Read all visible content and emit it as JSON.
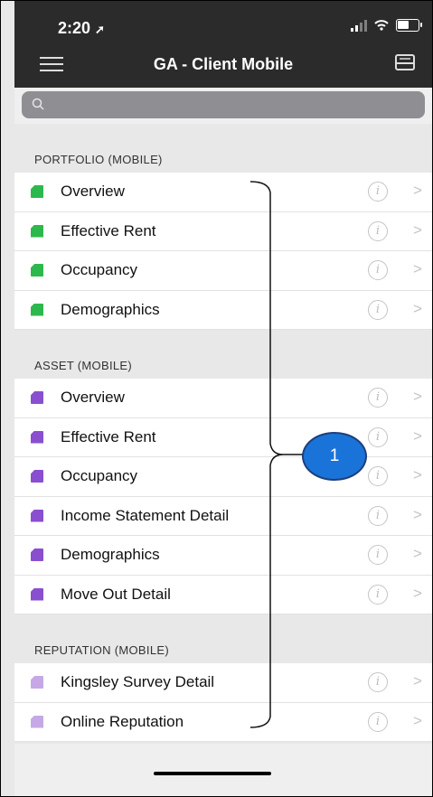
{
  "status": {
    "time": "2:20"
  },
  "nav": {
    "title": "GA - Client Mobile"
  },
  "search": {
    "placeholder": ""
  },
  "colors": {
    "portfolio": "#2db84d",
    "asset": "#8a4fcf",
    "reputation": "#c7a8e6",
    "callout": "#1a73d8"
  },
  "sections": [
    {
      "header": "PORTFOLIO (MOBILE)",
      "items": [
        "Overview",
        "Effective Rent",
        "Occupancy",
        "Demographics"
      ]
    },
    {
      "header": "ASSET (MOBILE)",
      "items": [
        "Overview",
        "Effective Rent",
        "Occupancy",
        "Income Statement Detail",
        "Demographics",
        "Move Out Detail"
      ]
    },
    {
      "header": "REPUTATION (MOBILE)",
      "items": [
        "Kingsley Survey Detail",
        "Online Reputation"
      ]
    }
  ],
  "row_icons": {
    "info": "i",
    "chevron": ">"
  },
  "callout": {
    "label": "1"
  }
}
